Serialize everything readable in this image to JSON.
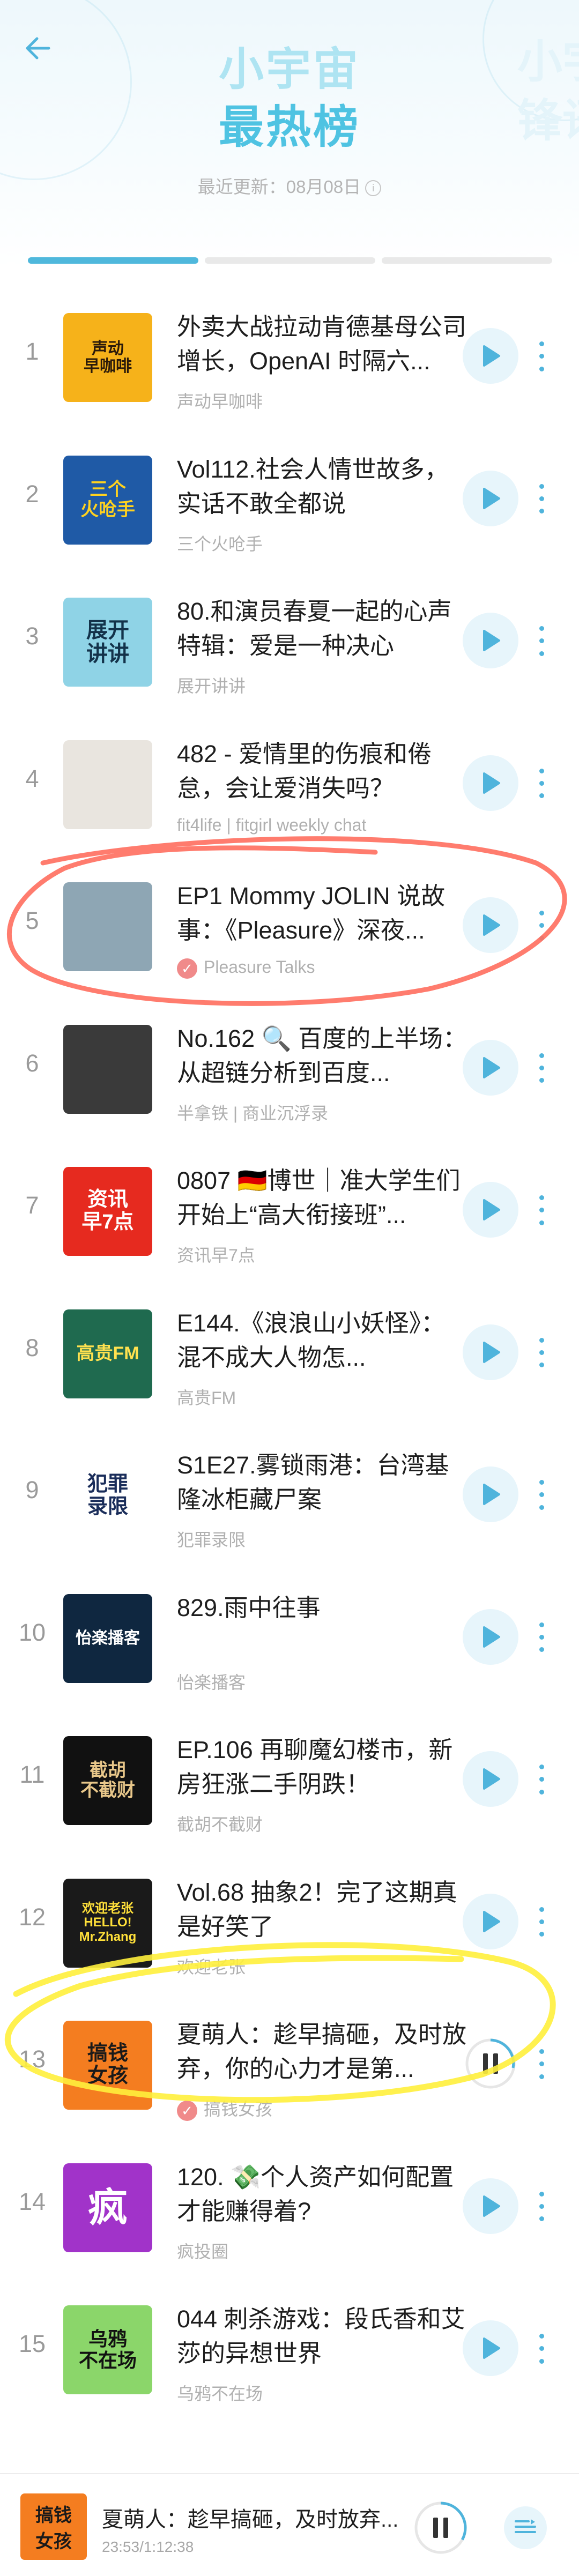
{
  "header": {
    "title_line1": "小宇宙",
    "title_line2": "最热榜",
    "ghost_title": "小宇\n锋讯",
    "update_label": "最近更新：",
    "update_date": "08月08日",
    "info_icon": "info-icon"
  },
  "colors": {
    "accent": "#4fc3e2",
    "play_bg": "#e7f5fb",
    "verified": "#f08a8a",
    "annotation_red": "#ff6e5e",
    "annotation_yellow": "#fff03c"
  },
  "episodes": [
    {
      "rank": "1",
      "title": "外卖大战拉动肯德基母公司增长，OpenAI 时隔六...",
      "author": "声动早咖啡",
      "cover_text": "声动\n早咖啡"
    },
    {
      "rank": "2",
      "title": "Vol112.社会人情世故多，实话不敢全都说",
      "author": "三个火呛手",
      "cover_text": "三个\n火呛手"
    },
    {
      "rank": "3",
      "title": "80.和演员春夏一起的心声特辑：爱是一种决心",
      "author": "展开讲讲",
      "cover_text": "展开\n讲讲"
    },
    {
      "rank": "4",
      "title": "482 - 爱情里的伤痕和倦怠，会让爱消失吗？",
      "author": "fit4life | fitgirl weekly chat",
      "cover_text": ""
    },
    {
      "rank": "5",
      "title": "EP1 Mommy JOLIN 说故事：《Pleasure》深夜...",
      "author": "Pleasure Talks",
      "cover_text": "",
      "verified": true
    },
    {
      "rank": "6",
      "title": "No.162 🔍 百度的上半场：从超链分析到百度...",
      "author": "半拿铁 | 商业沉浮录",
      "cover_text": ""
    },
    {
      "rank": "7",
      "title": "0807 🇩🇪博世｜准大学生们开始上“高大衔接班”...",
      "author": "资讯早7点",
      "cover_text": "资讯\n早7点"
    },
    {
      "rank": "8",
      "title": "E144.《浪浪山小妖怪》：混不成大人物怎...",
      "author": "高贵FM",
      "cover_text": "高贵FM"
    },
    {
      "rank": "9",
      "title": "S1E27.雾锁雨港：台湾基隆冰柜藏尸案",
      "author": "犯罪录限",
      "cover_text": "犯罪\n录限"
    },
    {
      "rank": "10",
      "title": "829.雨中往事",
      "author": "怡楽播客",
      "cover_text": "怡楽播客"
    },
    {
      "rank": "11",
      "title": "EP.106 再聊魔幻楼市，新房狂涨二手阴跌！",
      "author": "截胡不截财",
      "cover_text": "截胡\n不截财"
    },
    {
      "rank": "12",
      "title": "Vol.68 抽象2！完了这期真是好笑了",
      "author": "欢迎老张",
      "cover_text": "欢迎老张\nHELLO!\nMr.Zhang"
    },
    {
      "rank": "13",
      "title": "夏萌人：趁早搞砸，及时放弃，你的心力才是第...",
      "author": "搞钱女孩",
      "cover_text": "搞钱\n女孩",
      "verified": true,
      "playing": true
    },
    {
      "rank": "14",
      "title": "120. 💸个人资产如何配置才能赚得着?",
      "author": "疯投圈",
      "cover_text": "疯"
    },
    {
      "rank": "15",
      "title": "044 刺杀游戏：段氏香和艾莎的异想世界",
      "author": "乌鸦不在场",
      "cover_text": "乌鸦\n不在场"
    }
  ],
  "player": {
    "title": "夏萌人：趁早搞砸，及时放弃...",
    "time": "23:53/1:12:38",
    "cover_text": "搞钱\n女孩",
    "progress": 0.33
  }
}
